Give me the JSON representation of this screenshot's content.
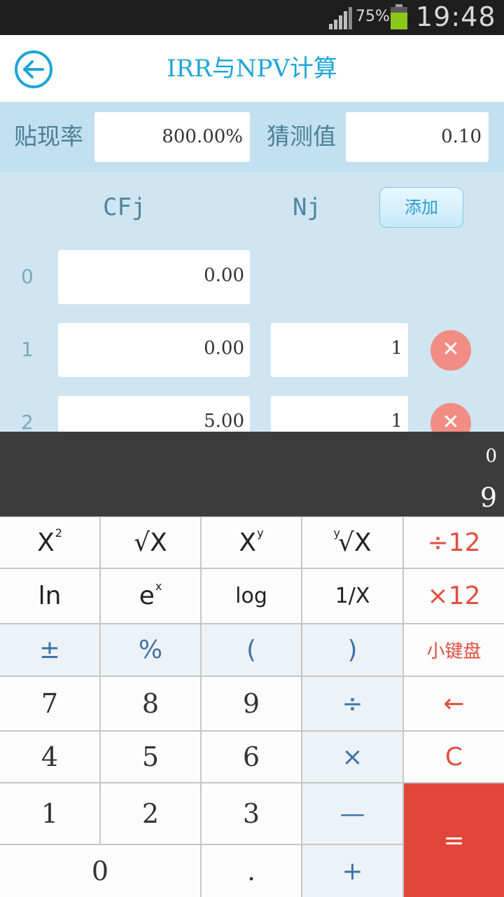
{
  "status_bar": {
    "battery": "75%",
    "time": "19:48"
  },
  "header": {
    "title": "IRR与NPV计算"
  },
  "rate_row": {
    "discount_label": "贴现率",
    "discount_value": "800.00%",
    "guess_label": "猜测值",
    "guess_value": "0.10"
  },
  "table": {
    "col_cf": "CFj",
    "col_n": "Nj",
    "add_label": "添加",
    "rows": [
      {
        "index": "0",
        "cf": "0.00"
      },
      {
        "index": "1",
        "cf": "0.00",
        "n": "1"
      },
      {
        "index": "2",
        "cf": "5.00",
        "n": "1"
      }
    ]
  },
  "display": {
    "previous": "0",
    "current": "9"
  },
  "keypad": {
    "x2": "X",
    "x2_sup": "2",
    "sqrt": "√X",
    "xy": "X",
    "xy_sup": "y",
    "yroot_pre": "y",
    "yroot": "√X",
    "div12": "÷12",
    "ln": "ln",
    "ex": "e",
    "ex_sup": "x",
    "log": "log",
    "recip": "1/X",
    "mul12": "×12",
    "plusminus": "±",
    "percent": "%",
    "lparen": "(",
    "rparen": ")",
    "mini_keypad": "小键盘",
    "n7": "7",
    "n8": "8",
    "n9": "9",
    "divide": "÷",
    "backspace": "←",
    "n4": "4",
    "n5": "5",
    "n6": "6",
    "multiply": "×",
    "clear": "C",
    "n1": "1",
    "n2": "2",
    "n3": "3",
    "minus": "—",
    "equals": "=",
    "n0": "0",
    "dot": ".",
    "plus": "+"
  }
}
